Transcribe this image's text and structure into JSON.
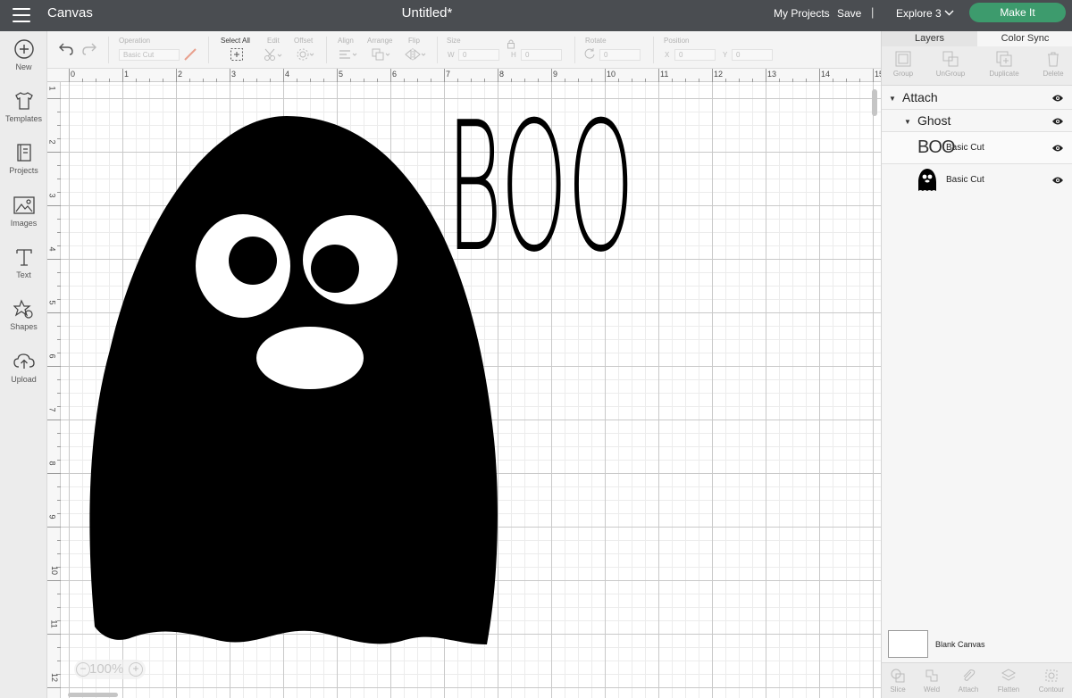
{
  "topbar": {
    "app_title": "Canvas",
    "document_title": "Untitled*",
    "my_projects": "My Projects",
    "save": "Save",
    "separator": "|",
    "machine": "Explore 3",
    "make_it": "Make It",
    "make_it_color": "#3d9b6d"
  },
  "leftrail": {
    "items": [
      {
        "label": "New",
        "icon": "plus-circle-icon"
      },
      {
        "label": "Templates",
        "icon": "tshirt-icon"
      },
      {
        "label": "Projects",
        "icon": "notebook-icon"
      },
      {
        "label": "Images",
        "icon": "image-icon"
      },
      {
        "label": "Text",
        "icon": "text-t-icon"
      },
      {
        "label": "Shapes",
        "icon": "shapes-icon"
      },
      {
        "label": "Upload",
        "icon": "cloud-upload-icon"
      }
    ]
  },
  "toolbar": {
    "operation_label": "Operation",
    "operation_value": "Basic Cut",
    "select_all_label": "Select All",
    "edit_label": "Edit",
    "offset_label": "Offset",
    "align_label": "Align",
    "arrange_label": "Arrange",
    "flip_label": "Flip",
    "size_label": "Size",
    "size_w_prefix": "W",
    "size_w_value": "0",
    "size_h_prefix": "H",
    "size_h_value": "0",
    "rotate_label": "Rotate",
    "rotate_value": "0",
    "position_label": "Position",
    "position_x_prefix": "X",
    "position_x_value": "0",
    "position_y_prefix": "Y",
    "position_y_value": "0"
  },
  "ruler": {
    "top_labels": [
      "0",
      "1",
      "2",
      "3",
      "4",
      "5",
      "6",
      "7",
      "8",
      "9",
      "10",
      "11",
      "12",
      "13",
      "14",
      "15"
    ],
    "left_labels": [
      "1",
      "2",
      "3",
      "4",
      "5",
      "6",
      "7",
      "8",
      "9",
      "10",
      "11",
      "12"
    ]
  },
  "canvas": {
    "boo_text": "BOO",
    "zoom": "100%",
    "zoom_minus": "−",
    "zoom_plus": "+"
  },
  "rightpanel": {
    "tabs": [
      "Layers",
      "Color Sync"
    ],
    "actions": [
      "Group",
      "UnGroup",
      "Duplicate",
      "Delete"
    ],
    "layers": {
      "attach": "Attach",
      "ghost": "Ghost",
      "item1_thumb_text": "BOO",
      "item1": "Basic Cut",
      "item2": "Basic Cut"
    },
    "blank_canvas": "Blank Canvas",
    "bottom_actions": [
      "Slice",
      "Weld",
      "Attach",
      "Flatten",
      "Contour"
    ]
  }
}
